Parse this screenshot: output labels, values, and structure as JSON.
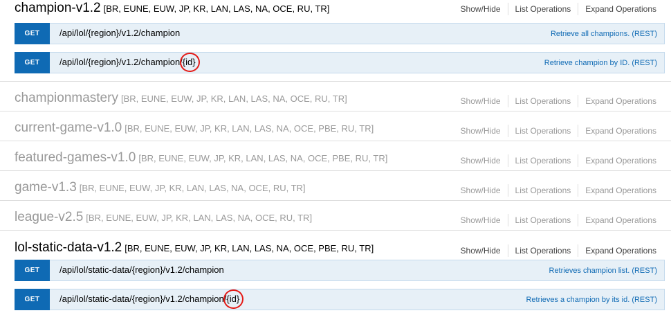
{
  "actions": {
    "show_hide": "Show/Hide",
    "list_ops": "List Operations",
    "expand_ops": "Expand Operations"
  },
  "resources": [
    {
      "name": "champion-v1.2",
      "regions": "[BR, EUNE, EUW, JP, KR, LAN, LAS, NA, OCE, RU, TR]",
      "expanded": true
    },
    {
      "name": "championmastery",
      "regions": "[BR, EUNE, EUW, JP, KR, LAN, LAS, NA, OCE, RU, TR]",
      "expanded": false
    },
    {
      "name": "current-game-v1.0",
      "regions": "[BR, EUNE, EUW, JP, KR, LAN, LAS, NA, OCE, PBE, RU, TR]",
      "expanded": false
    },
    {
      "name": "featured-games-v1.0",
      "regions": "[BR, EUNE, EUW, JP, KR, LAN, LAS, NA, OCE, PBE, RU, TR]",
      "expanded": false
    },
    {
      "name": "game-v1.3",
      "regions": "[BR, EUNE, EUW, JP, KR, LAN, LAS, NA, OCE, RU, TR]",
      "expanded": false
    },
    {
      "name": "league-v2.5",
      "regions": "[BR, EUNE, EUW, JP, KR, LAN, LAS, NA, OCE, RU, TR]",
      "expanded": false
    },
    {
      "name": "lol-static-data-v1.2",
      "regions": "[BR, EUNE, EUW, JP, KR, LAN, LAS, NA, OCE, PBE, RU, TR]",
      "expanded": true
    }
  ],
  "operations": [
    {
      "method": "GET",
      "path_prefix": "/api/lol/{region}/v1.2/champion",
      "path_param": "",
      "desc": "Retrieve all champions. (REST)"
    },
    {
      "method": "GET",
      "path_prefix": "/api/lol/{region}/v1.2/champion/",
      "path_param": "{id}",
      "desc": "Retrieve champion by ID. (REST)"
    },
    {
      "method": "GET",
      "path_prefix": "/api/lol/static-data/{region}/v1.2/champion",
      "path_param": "",
      "desc": "Retrieves champion list. (REST)"
    },
    {
      "method": "GET",
      "path_prefix": "/api/lol/static-data/{region}/v1.2/champion/",
      "path_param": "{id}",
      "desc": "Retrieves a champion by its id. (REST)"
    }
  ]
}
